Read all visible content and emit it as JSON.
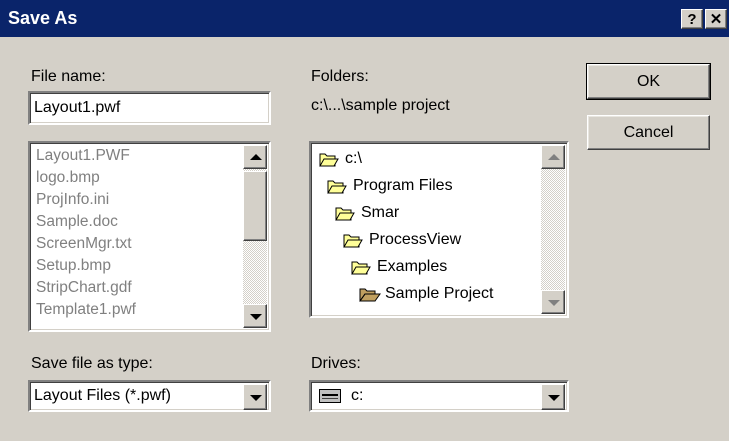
{
  "window": {
    "title": "Save As",
    "help_glyph": "?",
    "close_glyph": "✕"
  },
  "filename": {
    "label": "File name:",
    "value": "Layout1.pwf"
  },
  "files": [
    "Layout1.PWF",
    "logo.bmp",
    "ProjInfo.ini",
    "Sample.doc",
    "ScreenMgr.txt",
    "Setup.bmp",
    "StripChart.gdf",
    "Template1.pwf"
  ],
  "folders": {
    "label": "Folders:",
    "path": "c:\\...\\sample project",
    "tree": [
      "c:\\",
      "Program Files",
      "Smar",
      "ProcessView",
      "Examples",
      "Sample Project"
    ]
  },
  "buttons": {
    "ok": "OK",
    "cancel": "Cancel"
  },
  "save_type": {
    "label": "Save file as type:",
    "value": "Layout Files (*.pwf)"
  },
  "drives": {
    "label": "Drives:",
    "value": "c:"
  },
  "icons": {
    "folder": "folder-icon",
    "open_folder": "open-folder-icon",
    "drive": "drive-icon",
    "scroll_up": "scroll-up-icon",
    "scroll_down": "scroll-down-icon"
  }
}
